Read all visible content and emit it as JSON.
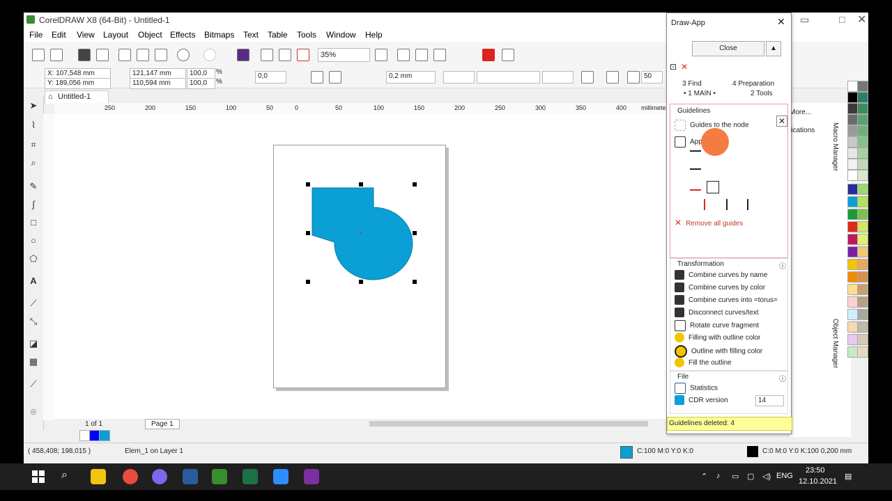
{
  "window": {
    "title": "CorelDRAW X8 (64-Bit) - Untitled-1"
  },
  "menu": [
    "File",
    "Edit",
    "View",
    "Layout",
    "Object",
    "Effects",
    "Bitmaps",
    "Text",
    "Table",
    "Tools",
    "Window",
    "Help"
  ],
  "toolbar": {
    "zoom": "35%"
  },
  "propbar": {
    "x": "X: 107,548 mm",
    "y": "Y: 189,056 mm",
    "w": "121,147 mm",
    "h": "110,594 mm",
    "sx": "100,0",
    "sy": "100,0",
    "unit": "%",
    "rotation": "0,0",
    "outline": "0,2 mm",
    "smooth": "50"
  },
  "doc": {
    "tab": "Untitled-1"
  },
  "ruler": {
    "labels": [
      "250",
      "200",
      "150",
      "100",
      "50",
      "0",
      "50",
      "100",
      "150",
      "200",
      "250",
      "300",
      "350",
      "400"
    ],
    "unit": "millimete"
  },
  "pagebar": {
    "counter": "1 of 1",
    "page": "Page 1"
  },
  "status": {
    "coords": "( 458,408; 198,015 )",
    "object": "Elem_1 on Layer 1",
    "fill": "C:100 M:0 Y:0 K:0",
    "outline": "C:0 M:0 Y:0 K:100 0,200 mm"
  },
  "dialog": {
    "title": "Draw-App",
    "close_label": "Close",
    "tabs": [
      "3 Find",
      "4 Preparation",
      "• 1 MAIN •",
      "2 Tools"
    ],
    "guidelines": {
      "header": "Guidelines",
      "items": [
        "Guides to the node",
        "App"
      ],
      "remove": "Remove all guides"
    },
    "transformation": {
      "header": "Transformation",
      "items": [
        "Combine curves by name",
        "Combine curves by color",
        "Combine curves into =torus=",
        "Disconnect curves/text",
        "Rotate curve fragment",
        "Filling with outline color",
        "Outline with filling color",
        "Fill the outline"
      ]
    },
    "file": {
      "header": "File",
      "items": [
        "Statistics",
        "CDR version"
      ],
      "version": "14"
    },
    "status": "Guidelines deleted: 4"
  },
  "dock": {
    "more": "More...",
    "apps": "lications",
    "labels": [
      "Macro Manager",
      "Object Manager"
    ]
  },
  "taskbar": {
    "lang": "ENG",
    "time": "23:50",
    "date": "12.10.2021"
  },
  "colors": {
    "shape": "#0aa0d6",
    "accent_red": "#e0281a",
    "tooltip": "#ffff99"
  }
}
